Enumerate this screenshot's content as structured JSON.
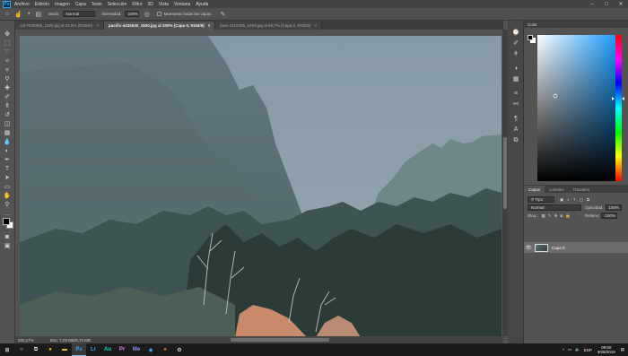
{
  "menu": {
    "logo": "Ps",
    "items": [
      "Archivo",
      "Edición",
      "Imagen",
      "Capa",
      "Texto",
      "Selección",
      "Filtro",
      "3D",
      "Vista",
      "Ventana",
      "Ayuda"
    ],
    "window_controls": [
      "–",
      "□",
      "✕"
    ]
  },
  "options": {
    "modo_label": "Modo:",
    "modo_value": "Normal",
    "intensidad_label": "Intensidad:",
    "intensidad_value": "100%",
    "sample_all_label": "Muestrear todas las capas"
  },
  "tabs": [
    {
      "label": "cat-7528955_1920.jpg al 34,5% (RGB/8)",
      "active": false
    },
    {
      "label": "pacific-4430530_1920.jpg al 200% (Capa 0, RGB/8)",
      "active": true
    },
    {
      "label": "poto-4410485_1920.jpg al 66,7% (Capa 0, RGB/8)",
      "active": false
    }
  ],
  "status": {
    "zoom": "200,17%",
    "doc": "Doc: 7,03 MB/8,70 MB"
  },
  "color_panel": {
    "title": "Color",
    "accent_blue": "#1a9cff",
    "hue_marker_color": "#ffffff"
  },
  "layers_panel": {
    "tabs": [
      "Capas",
      "Canales",
      "Trazados"
    ],
    "filter_label": "Tipo",
    "blend_mode": "Normal",
    "opacity_label": "Opacidad:",
    "opacity_value": "100%",
    "lock_label": "Bloq.:",
    "fill_label": "Relleno:",
    "fill_value": "100%",
    "layer_name": "Capa 0"
  },
  "taskbar": {
    "icons": [
      "windows-start",
      "search",
      "task-view",
      "chrome",
      "explorer",
      "photoshop",
      "lightroom",
      "audition",
      "premiere",
      "media-encoder",
      "vscode",
      "firefox",
      "settings"
    ],
    "language": "ESP",
    "time": "09:50",
    "date": "30/8/2019"
  }
}
